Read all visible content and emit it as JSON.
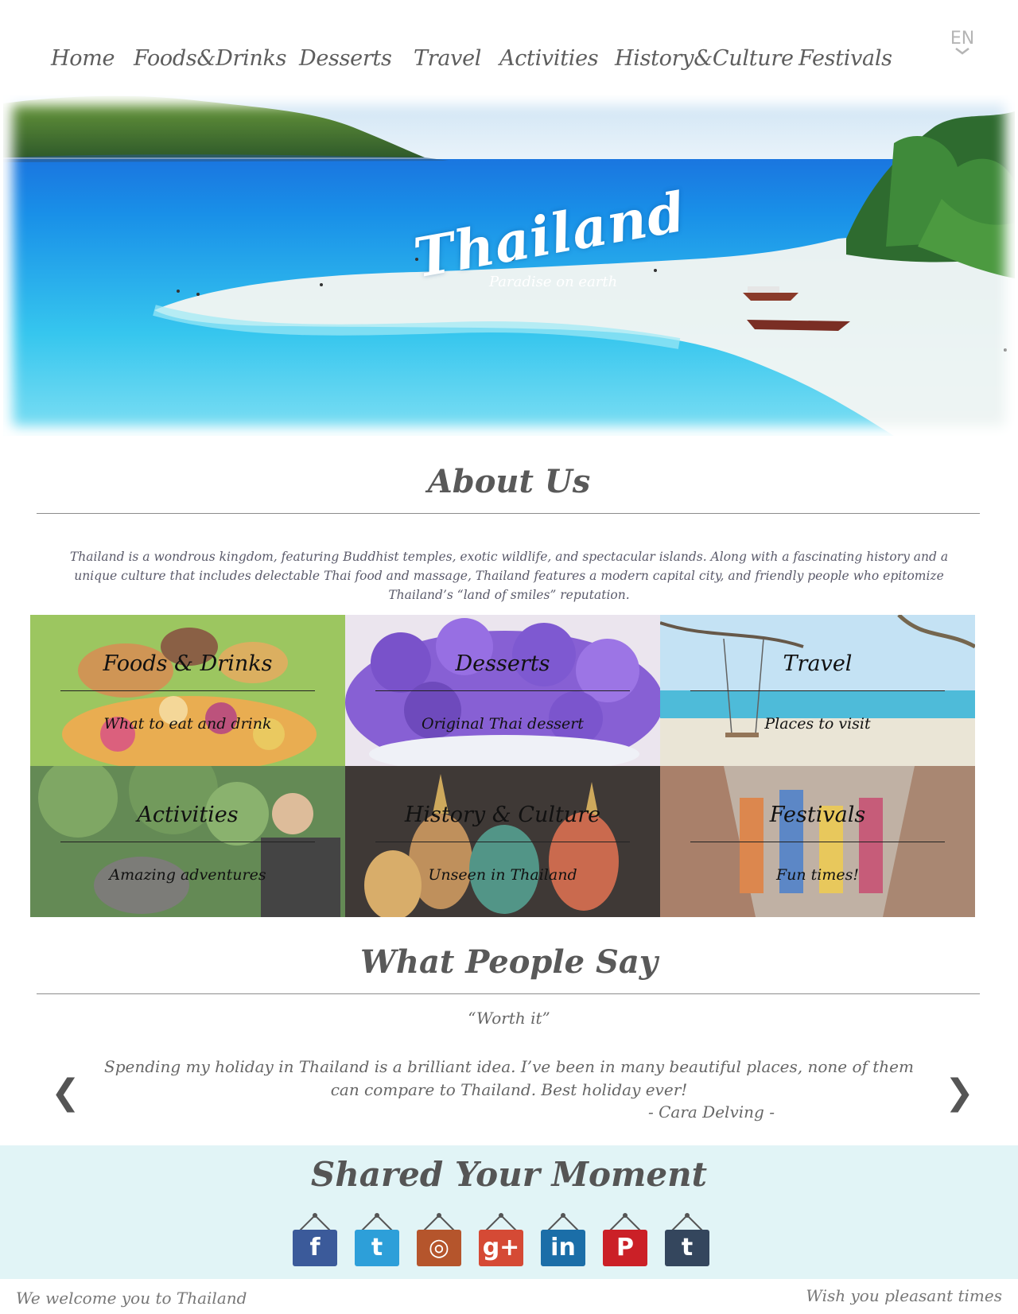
{
  "nav": {
    "items": [
      {
        "label": "Home"
      },
      {
        "label": "Foods&Drinks"
      },
      {
        "label": "Desserts"
      },
      {
        "label": "Travel"
      },
      {
        "label": "Activities"
      },
      {
        "label": "History&Culture"
      },
      {
        "label": "Festivals"
      }
    ],
    "language": "EN"
  },
  "hero": {
    "title": "Thailand",
    "tagline": "Paradise on earth",
    "slide_count": 5,
    "active_slide": 1
  },
  "about": {
    "heading": "About Us",
    "text": "Thailand is a wondrous kingdom, featuring Buddhist temples, exotic wildlife, and spectacular islands. Along with a fascinating history and a unique culture that includes delectable Thai food and massage, Thailand features a modern capital city, and friendly people who epitomize Thailand’s “land of smiles” reputation."
  },
  "categories": [
    {
      "title": "Foods & Drinks",
      "subtitle": "What to eat and drink"
    },
    {
      "title": "Desserts",
      "subtitle": "Original Thai dessert"
    },
    {
      "title": "Travel",
      "subtitle": "Places to visit"
    },
    {
      "title": "Activities",
      "subtitle": "Amazing adventures"
    },
    {
      "title": "History & Culture",
      "subtitle": "Unseen in Thailand"
    },
    {
      "title": "Festivals",
      "subtitle": "Fun times!"
    }
  ],
  "testimonials": {
    "heading": "What People Say",
    "headline": "“Worth it”",
    "body": "Spending my holiday in Thailand is a brilliant idea. I’ve been in many beautiful places, none of them can compare to Thailand. Best holiday ever!",
    "author": "- Cara Delving -",
    "prev_arrow": "❮",
    "next_arrow": "❯"
  },
  "share": {
    "heading": "Shared Your Moment",
    "networks": [
      {
        "name": "facebook-icon",
        "glyph": "f",
        "color": "#3b5a9a"
      },
      {
        "name": "twitter-icon",
        "glyph": "t",
        "color": "#2d9fd9"
      },
      {
        "name": "instagram-icon",
        "glyph": "◎",
        "color": "#b5552c"
      },
      {
        "name": "google-plus-icon",
        "glyph": "g+",
        "color": "#d54a35"
      },
      {
        "name": "linkedin-icon",
        "glyph": "in",
        "color": "#1b6ea8"
      },
      {
        "name": "pinterest-icon",
        "glyph": "P",
        "color": "#cb2027"
      },
      {
        "name": "tumblr-icon",
        "glyph": "t",
        "color": "#34465d"
      }
    ]
  },
  "footer": {
    "left": "We welcome you to Thailand",
    "right": "Wish you pleasant times"
  },
  "colors": {
    "share_background": "#e1f4f6",
    "text": "#5b5b5b"
  }
}
